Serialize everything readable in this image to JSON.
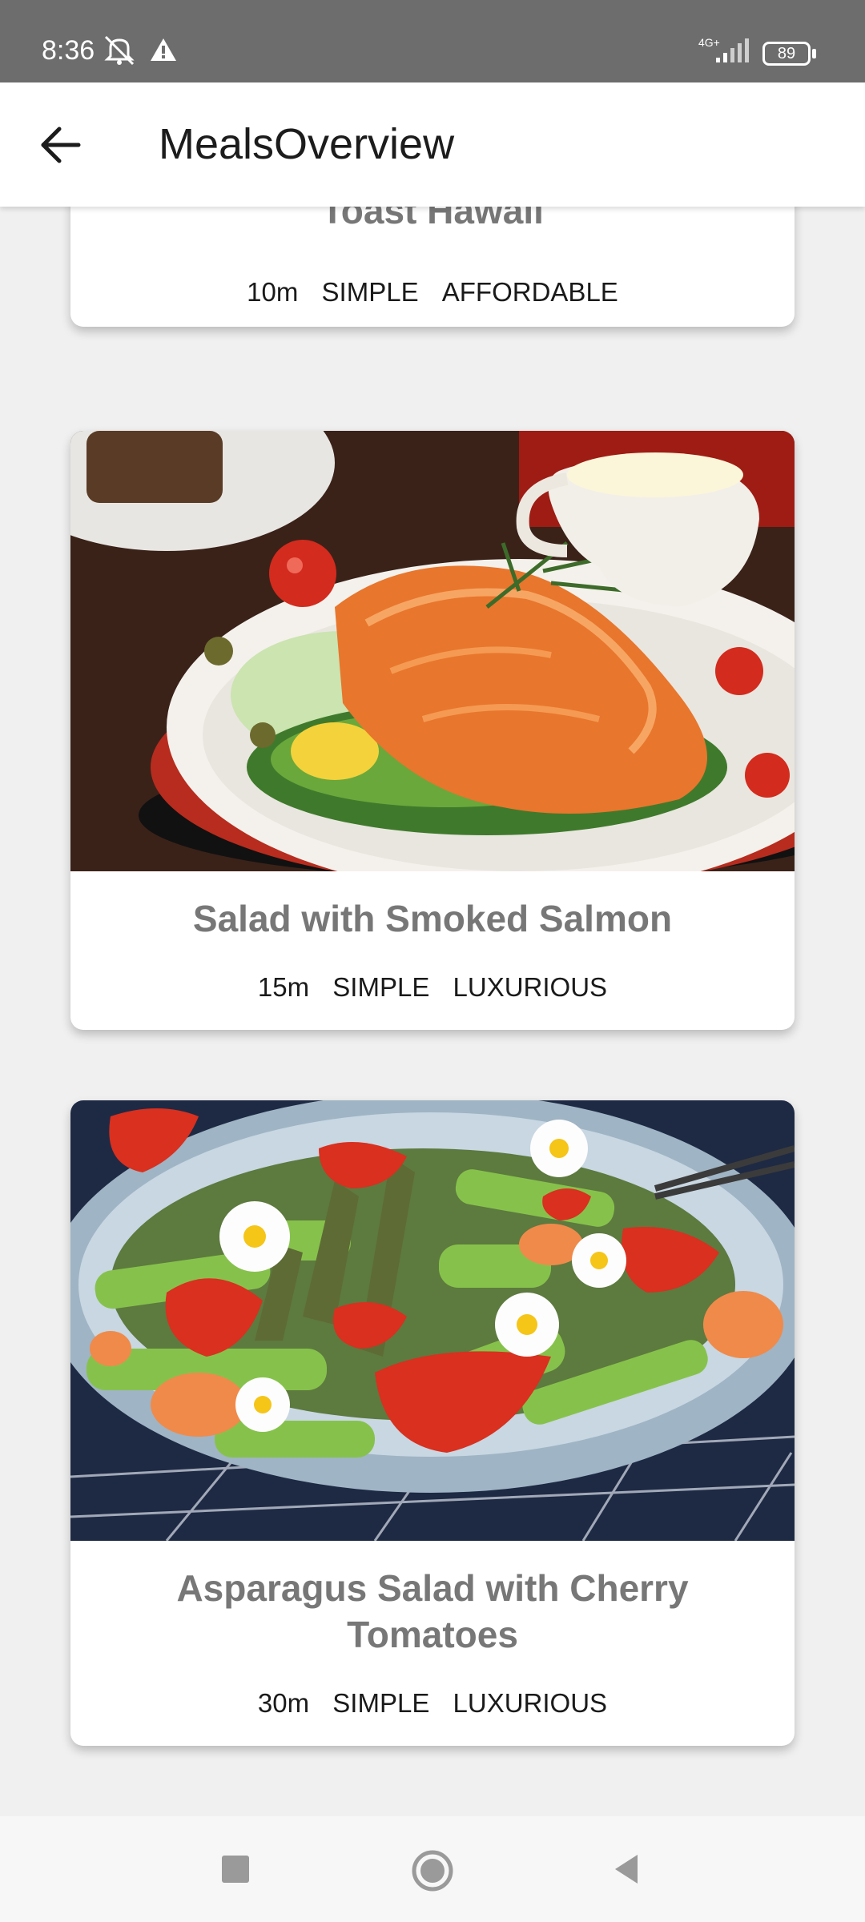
{
  "status_bar": {
    "time": "8:36",
    "network": "4G+",
    "battery": "89",
    "icons": [
      "mute-icon",
      "warning-icon",
      "signal-icon",
      "battery-icon"
    ]
  },
  "app_bar": {
    "title": "MealsOverview",
    "back_icon": "arrow-left-icon"
  },
  "meals": [
    {
      "title": "Toast Hawaii",
      "duration": "10m",
      "complexity": "SIMPLE",
      "affordability": "AFFORDABLE"
    },
    {
      "title": "Salad with Smoked Salmon",
      "duration": "15m",
      "complexity": "SIMPLE",
      "affordability": "LUXURIOUS"
    },
    {
      "title": "Asparagus Salad with Cherry Tomatoes",
      "duration": "30m",
      "complexity": "SIMPLE",
      "affordability": "LUXURIOUS"
    }
  ],
  "nav_bar": {
    "icons": [
      "recents-square-icon",
      "home-circle-icon",
      "back-triangle-icon"
    ]
  },
  "colors": {
    "status_bar": "#6d6d6d",
    "background": "#f0f0f0",
    "card": "#ffffff",
    "title_text": "#777777"
  }
}
